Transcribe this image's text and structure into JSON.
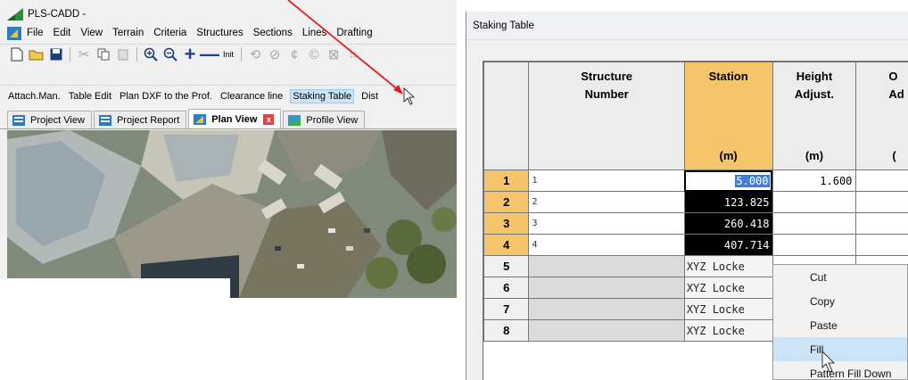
{
  "app": {
    "title": "PLS-CADD -",
    "menu": [
      "File",
      "Edit",
      "View",
      "Terrain",
      "Criteria",
      "Structures",
      "Sections",
      "Lines",
      "Drafting"
    ],
    "toolbar_init_label": "Init",
    "commands": [
      "Attach.Man.",
      "Table Edit",
      "Plan DXF to the Prof.",
      "Clearance line",
      "Staking Table",
      "Dist"
    ],
    "tabs": [
      {
        "label": "Project View",
        "icon": "project-view-icon"
      },
      {
        "label": "Project Report",
        "icon": "project-report-icon"
      },
      {
        "label": "Plan View",
        "icon": "plan-view-icon",
        "active": true
      },
      {
        "label": "Profile View",
        "icon": "profile-view-icon"
      }
    ]
  },
  "staking_table": {
    "title": "Staking Table",
    "columns": [
      {
        "label1": "",
        "label2": "",
        "unit": ""
      },
      {
        "label1": "Structure",
        "label2": "Number",
        "unit": ""
      },
      {
        "label1": "Station",
        "label2": "",
        "unit": "(m)"
      },
      {
        "label1": "Height",
        "label2": "Adjust.",
        "unit": "(m)"
      },
      {
        "label1": "O",
        "label2": "Ad",
        "unit": "("
      }
    ],
    "rows": [
      {
        "num": "1",
        "structure": "1",
        "station": "5.000",
        "height": "1.600"
      },
      {
        "num": "2",
        "structure": "2",
        "station": "123.825",
        "height": ""
      },
      {
        "num": "3",
        "structure": "3",
        "station": "260.418",
        "height": ""
      },
      {
        "num": "4",
        "structure": "4",
        "station": "407.714",
        "height": ""
      },
      {
        "num": "5",
        "structure": "",
        "station": "XYZ Locke",
        "height": ""
      },
      {
        "num": "6",
        "structure": "",
        "station": "XYZ Locke",
        "height": ""
      },
      {
        "num": "7",
        "structure": "",
        "station": "XYZ Locke",
        "height": ""
      },
      {
        "num": "8",
        "structure": "",
        "station": "XYZ Locke",
        "height": ""
      }
    ]
  },
  "context_menu": {
    "items": [
      "Cut",
      "Copy",
      "Paste",
      "Fill",
      "Pattern Fill Down"
    ]
  },
  "colors": {
    "selected_header": "#f5c56b",
    "annotation_arrow": "#e02020",
    "menu_hover": "#cde4f7"
  }
}
